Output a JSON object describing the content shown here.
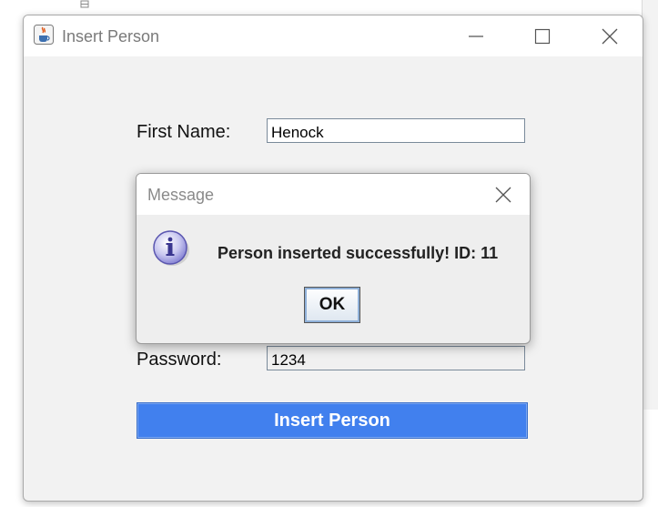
{
  "window": {
    "title": "Insert Person"
  },
  "form": {
    "first_name_label": "First Name:",
    "first_name_value": "Henock",
    "password_label": "Password:",
    "password_value": "1234",
    "submit_label": "Insert Person"
  },
  "dialog": {
    "title": "Message",
    "message": "Person inserted successfully! ID: 11",
    "ok_label": "OK"
  },
  "icons": {
    "app": "java-cup-icon",
    "minimize": "minimize-icon",
    "maximize": "maximize-icon",
    "close": "close-icon",
    "dialog_close": "close-icon",
    "info": "info-icon"
  },
  "colors": {
    "submit_button": "#4180ee",
    "dialog_ok_border": "#8fb0d8"
  }
}
